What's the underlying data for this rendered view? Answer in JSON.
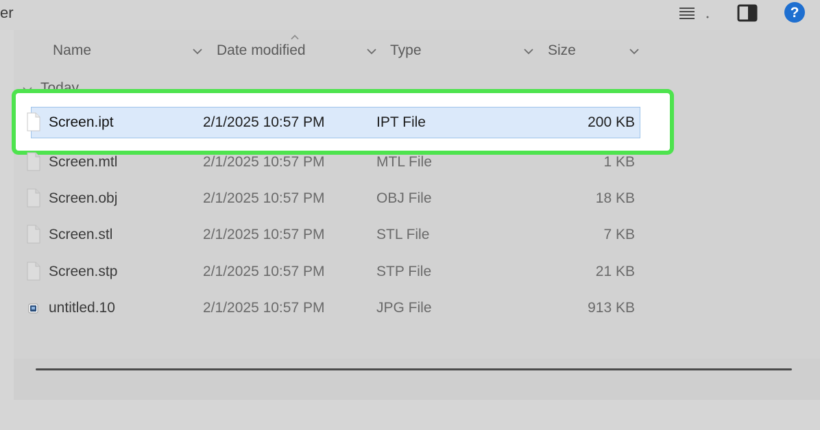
{
  "window": {
    "title_fragment": "er"
  },
  "toolbar": {
    "view_icon": "list-view-icon",
    "pane_icon": "preview-pane-icon",
    "help_icon": "help-icon"
  },
  "columns": {
    "name": "Name",
    "date_modified": "Date modified",
    "type": "Type",
    "size": "Size"
  },
  "group": {
    "label": "Today"
  },
  "files": [
    {
      "name": "Screen.ipt",
      "date": "2/1/2025 10:57 PM",
      "type": "IPT File",
      "size": "200 KB",
      "icon": "blank-file-icon"
    },
    {
      "name": "Screen.mtl",
      "date": "2/1/2025 10:57 PM",
      "type": "MTL File",
      "size": "1 KB",
      "icon": "blank-file-icon"
    },
    {
      "name": "Screen.obj",
      "date": "2/1/2025 10:57 PM",
      "type": "OBJ File",
      "size": "18 KB",
      "icon": "blank-file-icon"
    },
    {
      "name": "Screen.stl",
      "date": "2/1/2025 10:57 PM",
      "type": "STL File",
      "size": "7 KB",
      "icon": "blank-file-icon"
    },
    {
      "name": "Screen.stp",
      "date": "2/1/2025 10:57 PM",
      "type": "STP File",
      "size": "21 KB",
      "icon": "blank-file-icon"
    },
    {
      "name": "untitled.10",
      "date": "2/1/2025 10:57 PM",
      "type": "JPG File",
      "size": "913 KB",
      "icon": "image-file-icon"
    }
  ],
  "selection": {
    "selected_file": "Screen.ipt"
  },
  "colors": {
    "highlight_frame": "#4ee34e",
    "selection_fill": "#dbe9fa",
    "help_blue": "#1e6fd0"
  }
}
